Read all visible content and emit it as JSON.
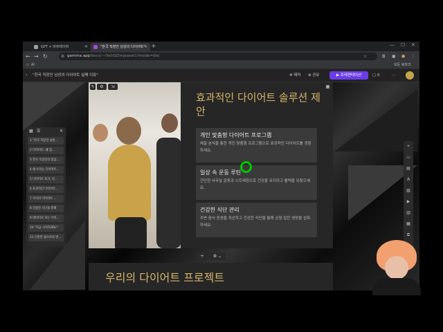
{
  "browser": {
    "tabs": [
      {
        "title": "GPT + 바뷰테이퍼",
        "active": false,
        "favicon_color": "#9aa0a6"
      },
      {
        "title": "\"한국 직장인 남성의 다이어트\"",
        "active": true,
        "favicon_color": "#a54bd6"
      }
    ],
    "new_tab": "+",
    "url_host": "gamma.app",
    "url_path": "/docs/~r9xh0ZImjeaeel1?mode=doc",
    "bookmark_left": "AI",
    "bookmark_right": "모든 북마크"
  },
  "app": {
    "breadcrumb": "\"한국 직장인 남성의 다이어트 실패 이유\"",
    "share_label": "공유",
    "theme_label": "테마",
    "present_label": "▶ 프레젠테이션",
    "comment_count": "0"
  },
  "slide": {
    "title": "효과적인 다이어트 솔루션 제안",
    "cards": [
      {
        "heading": "개인 맞춤형 다이어트 프로그램",
        "desc": "체질 분석을 통한 개인 맞춤형 프로그램으로 효과적인 다이어트를 경험하세요."
      },
      {
        "heading": "일상 속 운동 루틴",
        "desc": "간단한 사무실 운동과 스트레칭으로 건강을 유지하고 활력을 되찾으세요."
      },
      {
        "heading": "건강한 식단 관리",
        "desc": "주변 음식 환경을 개선하고 건강한 식단을 통해 균형 잡힌 영양을 섭취하세요."
      }
    ]
  },
  "outline": {
    "items": [
      "1 \"한국 직장인 남성...",
      "2 다이어트, 왜 힘...",
      "3 한국 직장인의 일상...",
      "4 왜 우리는 다이어트...",
      "5 다이어트 포기, 이...",
      "6 효과적인 다이어트...",
      "7 우리의 다이어트 ...",
      "8 건강한 식단을 향해",
      "9 데이터로 보는 다이...",
      "10 \"지금 시작하세요!\"",
      "11 건강한 삶으로의 변..."
    ]
  },
  "next_slide": {
    "title": "우리의 다이어트 프로젝트"
  },
  "colors": {
    "accent_gold": "#d6b56a",
    "present_button": "#6a3de8",
    "cursor_ring": "#00c800"
  }
}
